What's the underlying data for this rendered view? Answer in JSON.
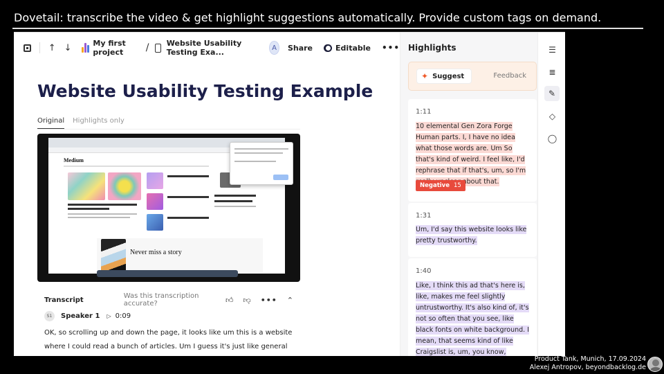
{
  "slide": {
    "title": "Dovetail: transcribe the video & get highlight suggestions automatically. Provide custom tags on demand.",
    "footer_line1": "Product Tank, Munich, 17.09.2024",
    "footer_line2": "Alexej Antropov, beyondbacklog.de"
  },
  "topbar": {
    "project_name": "My first project",
    "doc_name": "Website Usability Testing Exa...",
    "avatar_initial": "A",
    "share_label": "Share",
    "editable_label": "Editable",
    "more_label": "•••"
  },
  "document": {
    "title": "Website Usability Testing Example",
    "tabs": [
      {
        "label": "Original",
        "active": true
      },
      {
        "label": "Highlights only",
        "active": false
      }
    ]
  },
  "video": {
    "logo": "Medium",
    "cta_title": "Never miss a story"
  },
  "transcript": {
    "title": "Transcript",
    "question": "Was this transcription accurate?",
    "speaker_badge": "S1",
    "speaker_name": "Speaker 1",
    "timestamp": "0:09",
    "text": "OK, so scrolling up and down the page, it looks like um this is a website where I could read a bunch of articles. Um I guess it's just like general jo"
  },
  "highlights": {
    "title": "Highlights",
    "suggest_label": "Suggest",
    "feedback_label": "Feedback",
    "items": [
      {
        "time": "1:11",
        "text": "10 elemental Gen Zora Forge Human parts. I, I have no idea what those words are. Um So that's kind of weird. I feel like, I'd rephrase that if that's, um, so I'm really unclear about that.",
        "tag": "Negative",
        "tag_count": "15",
        "color": "#fbd9d4"
      },
      {
        "time": "1:31",
        "text": "Um, I'd say this website looks like pretty trustworthy.",
        "color": "#e4dbf7"
      },
      {
        "time": "1:40",
        "text": "Like, I think this ad that's here is, like, makes me feel slightly untrustworthy. It's also kind of, it's not so often that you see, like black fonts on white background. I mean, that seems kind of like Craigslist is, um, you know, they're like, still they never have",
        "color": "#e4dbf7"
      }
    ]
  },
  "colors": {
    "title_navy": "#1c1f4a",
    "suggest_orange": "#ef5a2a",
    "negative_red": "#e84a3c"
  }
}
